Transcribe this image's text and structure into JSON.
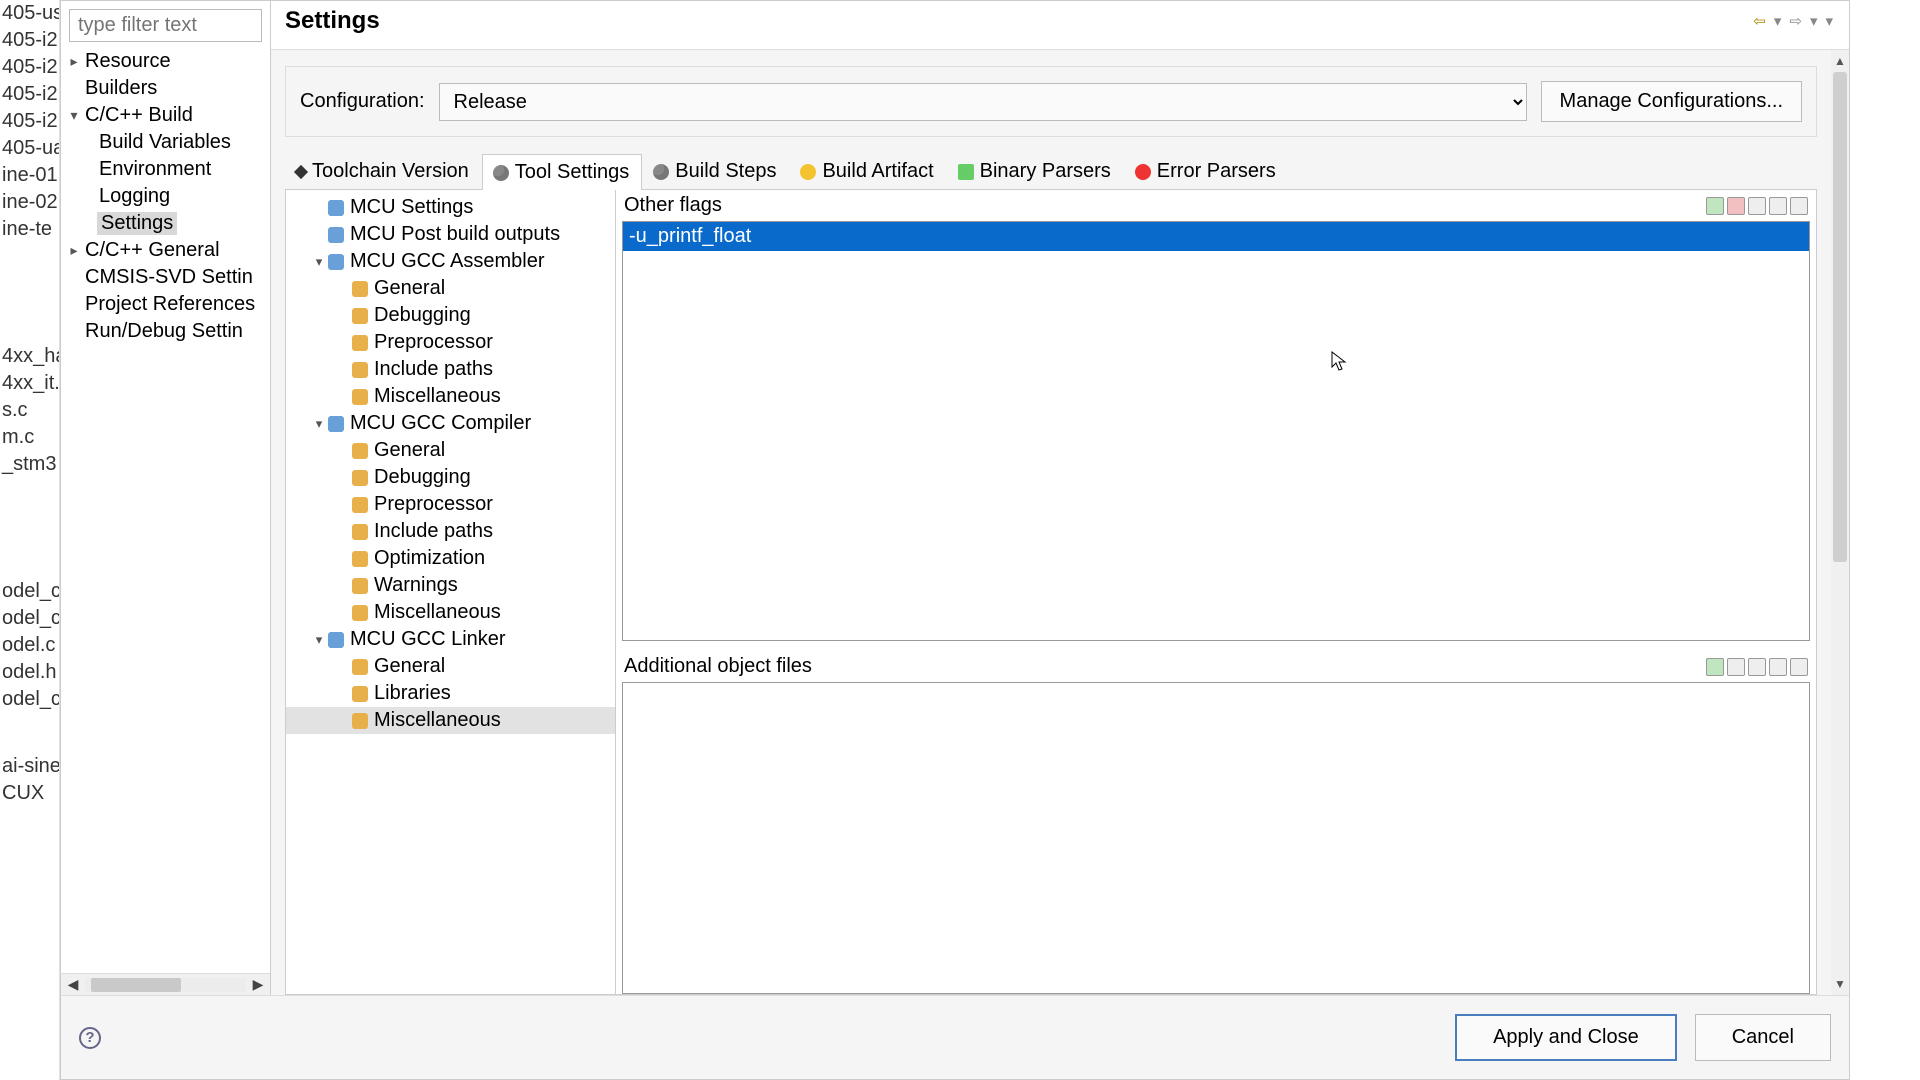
{
  "left_panel": {
    "items": [
      "405-us",
      "405-i2",
      "405-i2",
      "405-i2",
      "405-i2",
      "405-ua",
      "ine-01",
      "ine-02",
      "ine-te"
    ],
    "selected_index": 8,
    "group2": [
      "4xx_ha",
      "4xx_it.",
      "s.c",
      "m.c",
      "_stm3"
    ],
    "group3": [
      "odel_c",
      "odel_c",
      "odel.c",
      "odel.h",
      "odel_c"
    ],
    "group4": [
      "ai-sine",
      "CUX"
    ]
  },
  "filter_placeholder": "type filter text",
  "title": "Settings",
  "categories": [
    {
      "label": "Resource",
      "expand": true
    },
    {
      "label": "Builders"
    },
    {
      "label": "C/C++ Build",
      "expand": "open",
      "children": [
        "Build Variables",
        "Environment",
        "Logging",
        "Settings"
      ],
      "selected_child": 3
    },
    {
      "label": "C/C++ General",
      "expand": true
    },
    {
      "label": "CMSIS-SVD Settin"
    },
    {
      "label": "Project References"
    },
    {
      "label": "Run/Debug Settin"
    }
  ],
  "nav": {
    "back": "⇦",
    "back_menu": "▾",
    "fwd": "⇨",
    "fwd_menu": "▾",
    "menu": "▾"
  },
  "config_label": "Configuration:",
  "config_value": "Release",
  "manage_config": "Manage Configurations...",
  "tabs": [
    "Toolchain  Version",
    "Tool Settings",
    "Build Steps",
    "Build Artifact",
    "Binary Parsers",
    "Error Parsers"
  ],
  "active_tab": 1,
  "tool_tree": [
    {
      "label": "MCU Settings",
      "lvl": 1,
      "icon": "blue"
    },
    {
      "label": "MCU Post build outputs",
      "lvl": 1,
      "icon": "blue"
    },
    {
      "label": "MCU GCC Assembler",
      "lvl": 1,
      "icon": "blue",
      "exp": "open"
    },
    {
      "label": "General",
      "lvl": 2
    },
    {
      "label": "Debugging",
      "lvl": 2
    },
    {
      "label": "Preprocessor",
      "lvl": 2
    },
    {
      "label": "Include paths",
      "lvl": 2
    },
    {
      "label": "Miscellaneous",
      "lvl": 2
    },
    {
      "label": "MCU GCC Compiler",
      "lvl": 1,
      "icon": "blue",
      "exp": "open"
    },
    {
      "label": "General",
      "lvl": 2
    },
    {
      "label": "Debugging",
      "lvl": 2
    },
    {
      "label": "Preprocessor",
      "lvl": 2
    },
    {
      "label": "Include paths",
      "lvl": 2
    },
    {
      "label": "Optimization",
      "lvl": 2
    },
    {
      "label": "Warnings",
      "lvl": 2
    },
    {
      "label": "Miscellaneous",
      "lvl": 2
    },
    {
      "label": "MCU GCC Linker",
      "lvl": 1,
      "icon": "blue",
      "exp": "open"
    },
    {
      "label": "General",
      "lvl": 2
    },
    {
      "label": "Libraries",
      "lvl": 2
    },
    {
      "label": "Miscellaneous",
      "lvl": 2,
      "sel": true
    }
  ],
  "other_flags_label": "Other flags",
  "other_flags": [
    "-u_printf_float"
  ],
  "addl_obj_label": "Additional object files",
  "addl_obj": [],
  "apply_close": "Apply and Close",
  "cancel": "Cancel"
}
